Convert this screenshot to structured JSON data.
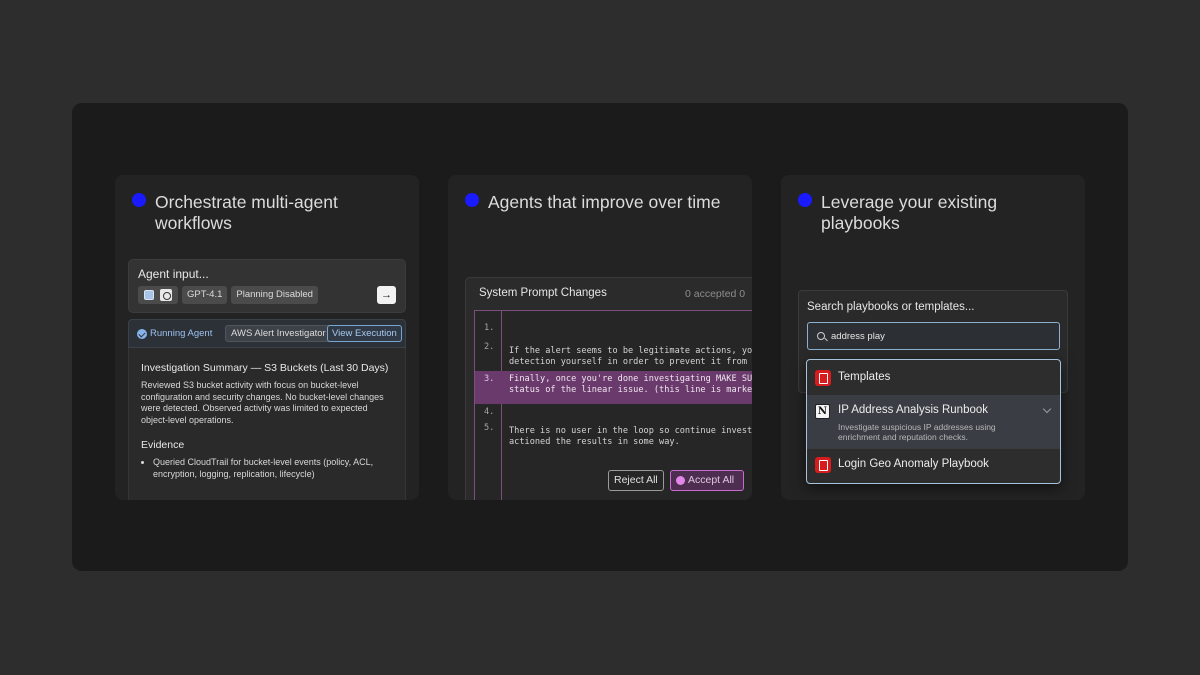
{
  "cards": [
    {
      "title": "Orchestrate multi-agent workflows",
      "agent_input": {
        "placeholder": "Agent input...",
        "model": "GPT-4.1",
        "planning": "Planning Disabled"
      },
      "run_bar": {
        "status": "Running Agent",
        "agent_name": "AWS Alert Investigator",
        "action": "View Execution"
      },
      "summary": {
        "title": "Investigation Summary — S3 Buckets (Last 30 Days)",
        "body": "Reviewed S3 bucket activity with focus on bucket-level configuration and security changes. No bucket-level changes were detected. Observed activity was limited to expected object-level operations.",
        "evidence_title": "Evidence",
        "evidence_items": [
          "Queried CloudTrail for bucket-level events (policy, ACL, encryption, logging, replication, lifecycle)"
        ]
      }
    },
    {
      "title": "Agents that improve over time",
      "panel_title": "System Prompt Changes",
      "accepted_label": "0 accepted  0",
      "lines": [
        {
          "num": "1.",
          "text": ""
        },
        {
          "num": "2.",
          "text": "If the alert seems to be legitimate actions, you shoul\ndetection yourself in order to prevent it from happen"
        },
        {
          "num": "3.",
          "text": "Finally, once you're done investigating MAKE SURE y\nstatus of the linear issue. (this line is marked as remo"
        },
        {
          "num": "4.",
          "text": ""
        },
        {
          "num": "5.",
          "text": "There is no user in the loop so continue investigating\nactioned the results in some way."
        }
      ],
      "reject_label": "Reject All",
      "accept_label": "Accept All"
    },
    {
      "title": "Leverage your existing playbooks",
      "search_title": "Search playbooks or templates...",
      "search_value": "address play",
      "results": [
        {
          "label": "Templates",
          "icon": "pdf-icon"
        },
        {
          "label": "IP Address Analysis Runbook",
          "icon": "notion-icon",
          "description": "Investigate suspicious IP addresses using enrichment and reputation checks."
        },
        {
          "label": "Login Geo Anomaly Playbook",
          "icon": "pdf-icon"
        }
      ]
    }
  ],
  "colors": {
    "accent_dot": "#1a1aff",
    "diff_added": "#6a3a6d",
    "running_blue": "#86b4ea"
  }
}
